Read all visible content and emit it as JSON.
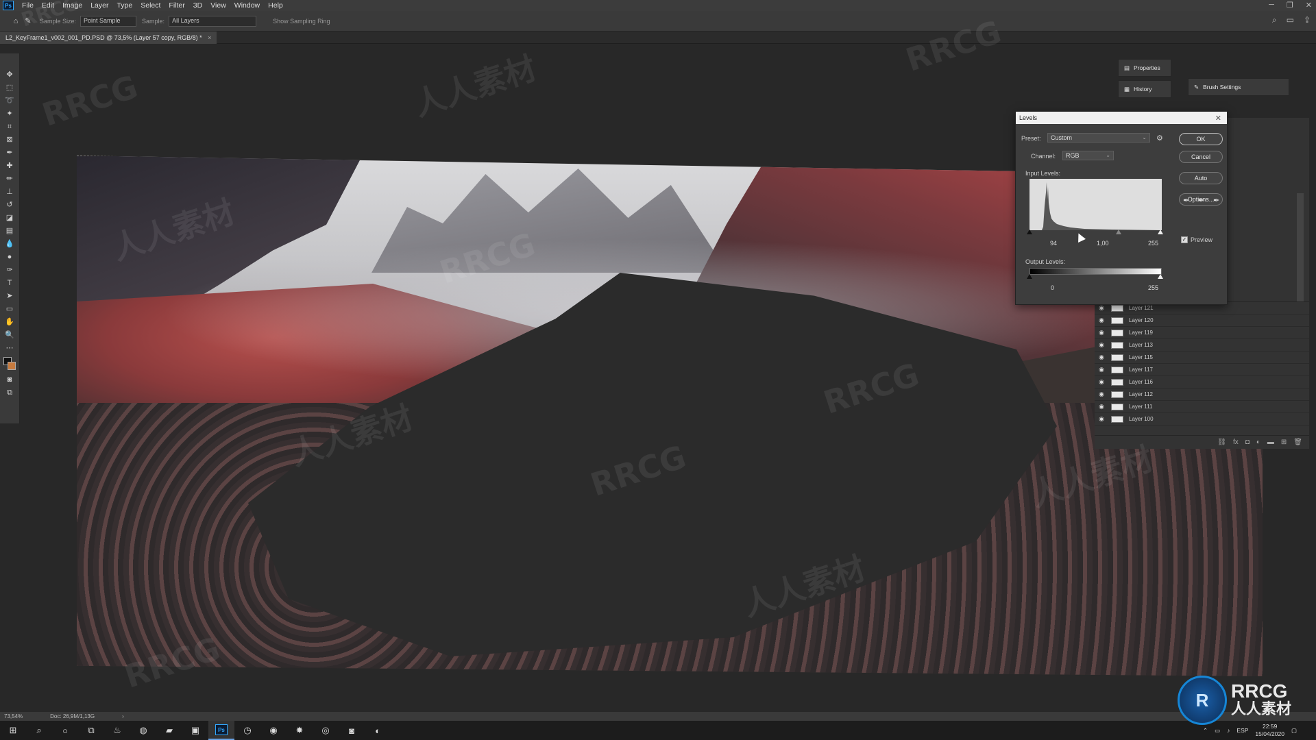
{
  "menubar": {
    "items": [
      "File",
      "Edit",
      "Image",
      "Layer",
      "Type",
      "Select",
      "Filter",
      "3D",
      "View",
      "Window",
      "Help"
    ]
  },
  "options_bar": {
    "sample_size_label": "Sample Size:",
    "sample_size_value": "Point Sample",
    "sample_label": "Sample:",
    "sample_value": "All Layers",
    "show_ring_label": "Show Sampling Ring"
  },
  "document_tab": {
    "title": "L2_KeyFrame1_v002_001_PD.PSD @ 73,5% (Layer 57 copy, RGB/8) *"
  },
  "panels": {
    "properties": "Properties",
    "history": "History",
    "brush_settings": "Brush Settings"
  },
  "levels_dialog": {
    "title": "Levels",
    "preset_label": "Preset:",
    "preset_value": "Custom",
    "channel_label": "Channel:",
    "channel_value": "RGB",
    "input_levels_label": "Input Levels:",
    "input_black": "94",
    "input_gamma": "1,00",
    "input_white": "255",
    "output_levels_label": "Output Levels:",
    "output_black": "0",
    "output_white": "255",
    "ok_label": "OK",
    "cancel_label": "Cancel",
    "auto_label": "Auto",
    "options_label": "Options...",
    "preview_label": "Preview",
    "preview_checked": true
  },
  "layers": {
    "rows": [
      "Layer 121",
      "Layer 120",
      "Layer 119",
      "Layer 113",
      "Layer 115",
      "Layer 117",
      "Layer 116",
      "Layer 112",
      "Layer 111",
      "Layer 100"
    ]
  },
  "status_bar": {
    "zoom": "73,54%",
    "doc": "Doc: 26,9M/1,13G"
  },
  "taskbar": {
    "time": "22:59",
    "date": "15/04/2020",
    "lang": "ESP"
  },
  "watermark": {
    "text1": "RRCG",
    "text2": "人人素材"
  },
  "colors": {
    "accent": "#31a8ff",
    "dialog_bg": "#3d3d3d",
    "fg_swatch": "#101010",
    "bg_swatch": "#c67a3e"
  }
}
